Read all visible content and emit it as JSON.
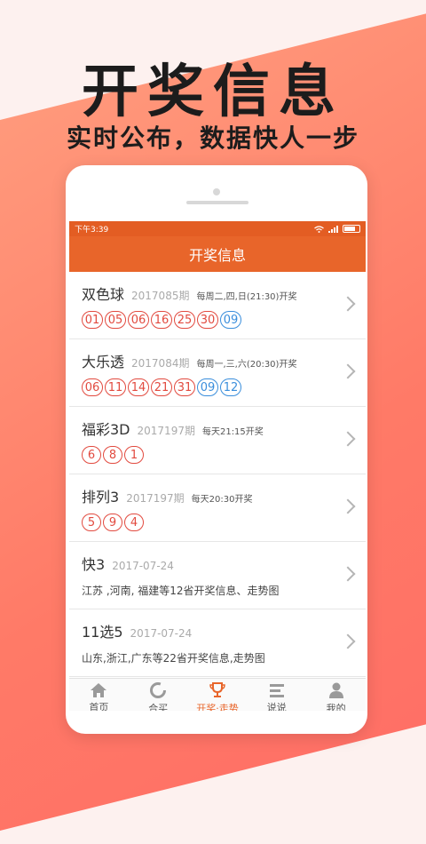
{
  "promo": {
    "title": "开奖信息",
    "subtitle": "实时公布，数据快人一步"
  },
  "status_bar": {
    "time": "下午3:39"
  },
  "app_bar": {
    "title": "开奖信息"
  },
  "lotteries": [
    {
      "name": "双色球",
      "issue": "2017085期",
      "schedule": "每周二,四,日(21:30)开奖",
      "red": [
        "01",
        "05",
        "06",
        "16",
        "25",
        "30"
      ],
      "blue": [
        "09"
      ]
    },
    {
      "name": "大乐透",
      "issue": "2017084期",
      "schedule": "每周一,三,六(20:30)开奖",
      "red": [
        "06",
        "11",
        "14",
        "21",
        "31"
      ],
      "blue": [
        "09",
        "12"
      ]
    },
    {
      "name": "福彩3D",
      "issue": "2017197期",
      "schedule": "每天21:15开奖",
      "red": [
        "6",
        "8",
        "1"
      ]
    },
    {
      "name": "排列3",
      "issue": "2017197期",
      "schedule": "每天20:30开奖",
      "red": [
        "5",
        "9",
        "4"
      ]
    },
    {
      "name": "快3",
      "date": "2017-07-24",
      "desc": "江苏 ,河南, 福建等12省开奖信息、走势图"
    },
    {
      "name": "11选5",
      "date": "2017-07-24",
      "desc": "山东,浙江,广东等22省开奖信息,走势图"
    }
  ],
  "tabs": [
    {
      "label": "首页",
      "icon": "home-icon",
      "active": false
    },
    {
      "label": "合买",
      "icon": "ring-icon",
      "active": false
    },
    {
      "label": "开奖·走势",
      "icon": "trophy-icon",
      "active": true
    },
    {
      "label": "说说",
      "icon": "list-icon",
      "active": false
    },
    {
      "label": "我的",
      "icon": "user-icon",
      "active": false
    }
  ],
  "colors": {
    "accent": "#e8652a",
    "red_ball": "#e24a3f",
    "blue_ball": "#3a8edc"
  }
}
